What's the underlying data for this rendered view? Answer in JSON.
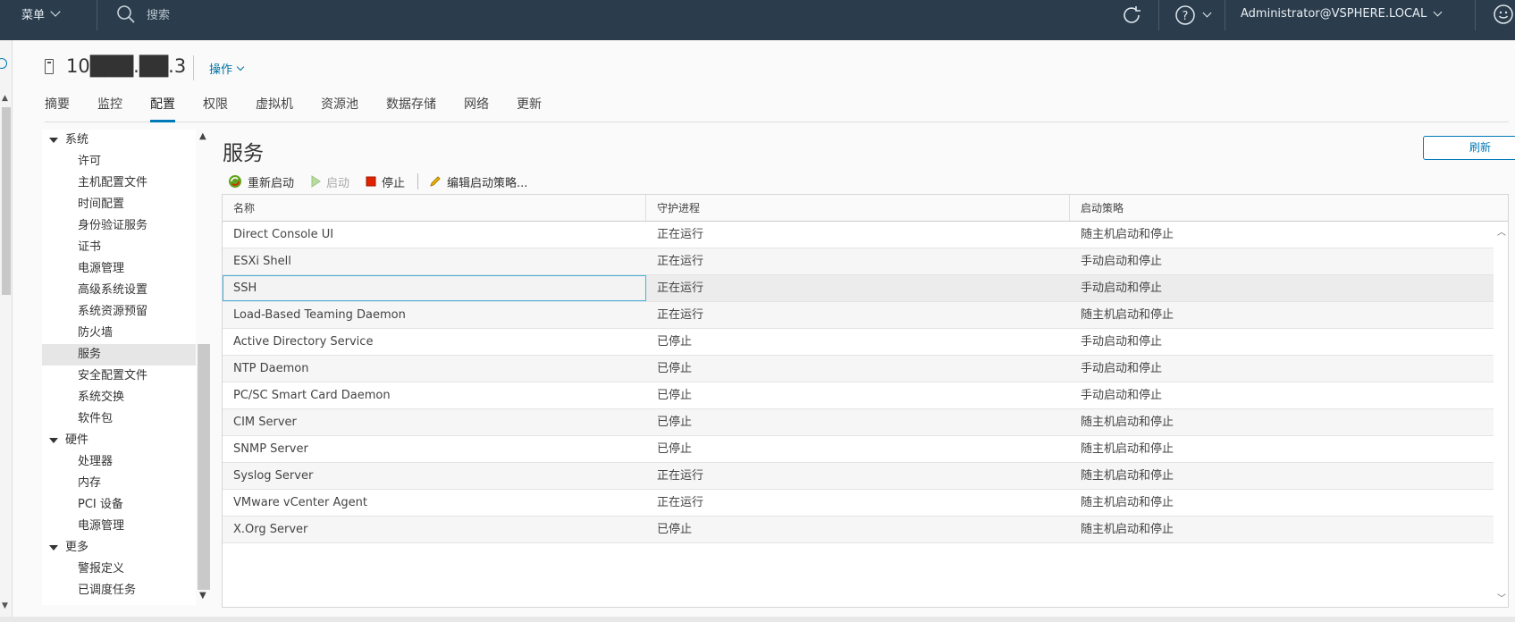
{
  "topbar": {
    "menu_label": "菜单",
    "search_placeholder": "搜索",
    "user_label": "Administrator@VSPHERE.LOCAL"
  },
  "header": {
    "host_name": "10███.██.3",
    "actions_label": "操作"
  },
  "tabs": [
    {
      "label": "摘要"
    },
    {
      "label": "监控"
    },
    {
      "label": "配置",
      "active": true
    },
    {
      "label": "权限"
    },
    {
      "label": "虚拟机"
    },
    {
      "label": "资源池"
    },
    {
      "label": "数据存储"
    },
    {
      "label": "网络"
    },
    {
      "label": "更新"
    }
  ],
  "tree": {
    "groups": [
      {
        "label": "系统",
        "items": [
          "许可",
          "主机配置文件",
          "时间配置",
          "身份验证服务",
          "证书",
          "电源管理",
          "高级系统设置",
          "系统资源预留",
          "防火墙",
          "服务",
          "安全配置文件",
          "系统交换",
          "软件包"
        ]
      },
      {
        "label": "硬件",
        "items": [
          "处理器",
          "内存",
          "PCI 设备",
          "电源管理"
        ]
      },
      {
        "label": "更多",
        "items": [
          "警报定义",
          "已调度任务"
        ]
      }
    ],
    "selected": "服务"
  },
  "panel": {
    "title": "服务",
    "refresh_label": "刷新",
    "toolbar": {
      "restart": "重新启动",
      "start": "启动",
      "stop": "停止",
      "edit_policy": "编辑启动策略..."
    }
  },
  "table": {
    "columns": [
      "名称",
      "守护进程",
      "启动策略"
    ],
    "rows": [
      [
        "Direct Console UI",
        "正在运行",
        "随主机启动和停止"
      ],
      [
        "ESXi Shell",
        "正在运行",
        "手动启动和停止"
      ],
      [
        "SSH",
        "正在运行",
        "手动启动和停止"
      ],
      [
        "Load-Based Teaming Daemon",
        "正在运行",
        "随主机启动和停止"
      ],
      [
        "Active Directory Service",
        "已停止",
        "手动启动和停止"
      ],
      [
        "NTP Daemon",
        "已停止",
        "手动启动和停止"
      ],
      [
        "PC/SC Smart Card Daemon",
        "已停止",
        "手动启动和停止"
      ],
      [
        "CIM Server",
        "已停止",
        "随主机启动和停止"
      ],
      [
        "SNMP Server",
        "已停止",
        "随主机启动和停止"
      ],
      [
        "Syslog Server",
        "正在运行",
        "随主机启动和停止"
      ],
      [
        "VMware vCenter Agent",
        "正在运行",
        "随主机启动和停止"
      ],
      [
        "X.Org Server",
        "已停止",
        "随主机启动和停止"
      ]
    ],
    "selected_row": 2
  },
  "colors": {
    "topbar_bg": "#2b3d4d",
    "accent": "#0079b8",
    "stop_red": "#e12200",
    "start_green": "#62a420"
  }
}
